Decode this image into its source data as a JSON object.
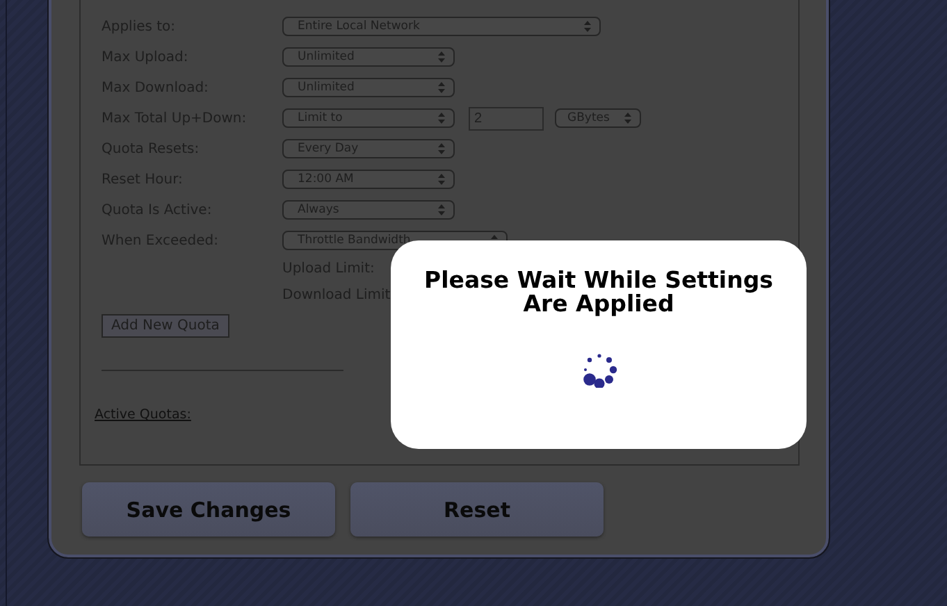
{
  "form": {
    "fields": [
      {
        "label": "Applies to:",
        "controls": [
          {
            "kind": "wide-select",
            "value": "Entire Local Network"
          }
        ]
      },
      {
        "label": "Max Upload:",
        "controls": [
          {
            "kind": "select",
            "value": "Unlimited"
          }
        ]
      },
      {
        "label": "Max Download:",
        "controls": [
          {
            "kind": "select",
            "value": "Unlimited"
          }
        ]
      },
      {
        "label": "Max Total Up+Down:",
        "controls": [
          {
            "kind": "select",
            "value": "Limit to"
          },
          {
            "kind": "input",
            "value": "2"
          },
          {
            "kind": "small-select",
            "value": "GBytes"
          }
        ]
      },
      {
        "label": "Quota Resets:",
        "controls": [
          {
            "kind": "select",
            "value": "Every Day"
          }
        ]
      },
      {
        "label": "Reset Hour:",
        "controls": [
          {
            "kind": "select",
            "value": "12:00 AM"
          }
        ]
      },
      {
        "label": "Quota Is Active:",
        "controls": [
          {
            "kind": "select",
            "value": "Always"
          }
        ]
      },
      {
        "label": "When Exceeded:",
        "controls": [
          {
            "kind": "medium-select",
            "value": "Throttle Bandwidth"
          }
        ]
      }
    ],
    "sub_labels": [
      "Upload Limit:",
      "Download Limit"
    ],
    "add_button": "Add New Quota",
    "active_quotas_link": "Active Quotas:"
  },
  "buttons": [
    "Save Changes",
    "Reset"
  ],
  "modal": {
    "title": "Please Wait While Settings Are Applied"
  }
}
